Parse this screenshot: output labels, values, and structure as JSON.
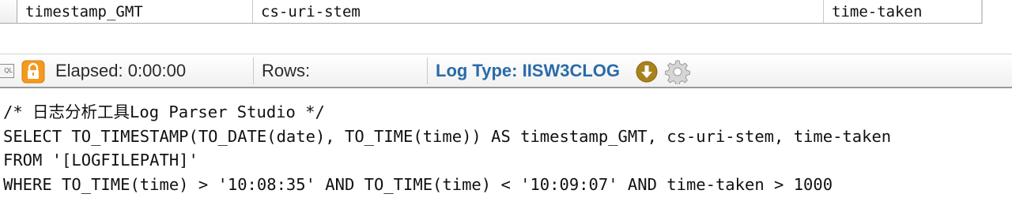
{
  "grid": {
    "columns": [
      "timestamp_GMT",
      "cs-uri-stem",
      "time-taken"
    ]
  },
  "statusbar": {
    "sql_icon_text": "QL",
    "elapsed_label": "Elapsed: 0:00:00",
    "rows_label": "Rows:",
    "log_type_label": "Log Type: IISW3CLOG",
    "colors": {
      "log_type": "#2a6ba8",
      "lock": "#f39a1e",
      "download": "#a9821c"
    },
    "icons": [
      "sql-icon",
      "lock-icon",
      "download-icon",
      "gear-icon"
    ]
  },
  "editor": {
    "lines": [
      "/* 日志分析工具Log Parser Studio */",
      "SELECT TO_TIMESTAMP(TO_DATE(date), TO_TIME(time)) AS timestamp_GMT, cs-uri-stem, time-taken",
      "FROM '[LOGFILEPATH]'",
      "WHERE TO_TIME(time) > '10:08:35' AND TO_TIME(time) < '10:09:07' AND time-taken > 1000"
    ]
  }
}
